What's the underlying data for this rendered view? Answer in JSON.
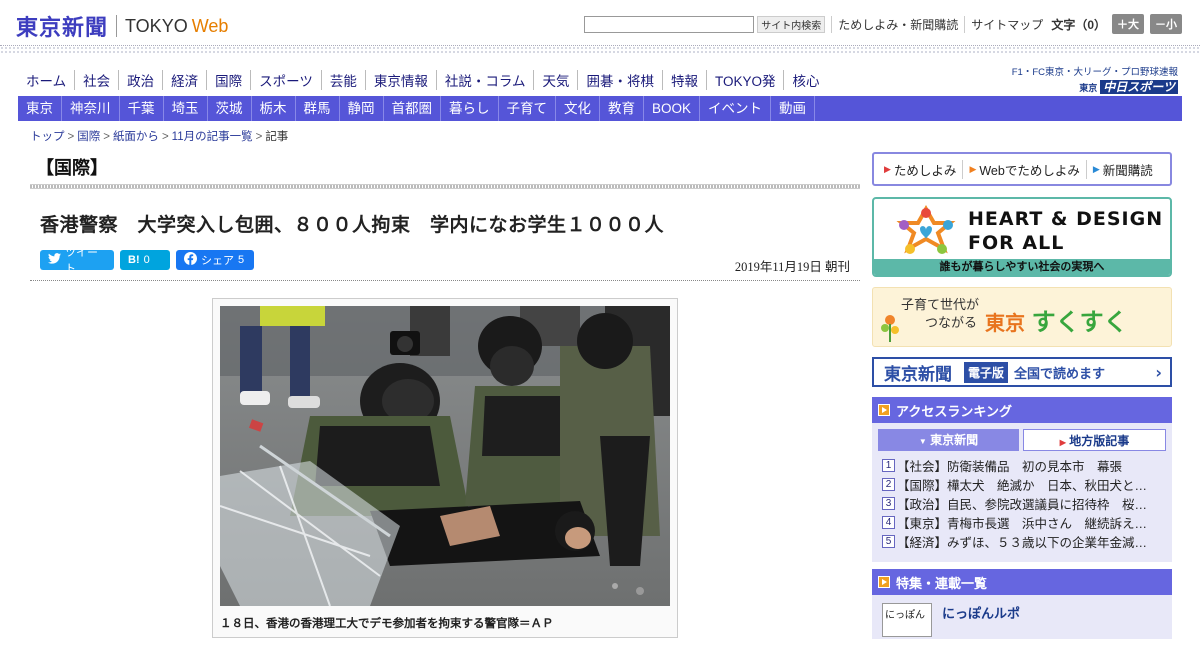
{
  "header": {
    "logo_kanji": "東京新聞",
    "logo_tokyo": "TOKYO",
    "logo_web": "Web",
    "search_value": "",
    "search_button": "サイト内検索",
    "links": [
      "ためしよみ・新聞購読",
      "サイトマップ"
    ],
    "font_label": "文字（0）",
    "font_bigger": "＋大",
    "font_smaller": "－小"
  },
  "nav_top": [
    "ホーム",
    "社会",
    "政治",
    "経済",
    "国際",
    "スポーツ",
    "芸能",
    "東京情報",
    "社説・コラム",
    "天気",
    "囲碁・将棋",
    "特報",
    "TOKYO発",
    "核心"
  ],
  "nav_brand": {
    "line1": "F1・FC東京・大リーグ・プロ野球速報",
    "prefix": "東京",
    "name": "中日スポーツ"
  },
  "nav_bottom": [
    "東京",
    "神奈川",
    "千葉",
    "埼玉",
    "茨城",
    "栃木",
    "群馬",
    "静岡",
    "首都圏",
    "暮らし",
    "子育て",
    "文化",
    "教育",
    "BOOK",
    "イベント",
    "動画"
  ],
  "breadcrumb": [
    "トップ",
    "国際",
    "紙面から",
    "11月の記事一覧",
    "記事"
  ],
  "article": {
    "section": "【国際】",
    "headline": "香港警察　大学突入し包囲、８００人拘束　学内になお学生１０００人",
    "share": {
      "tweet": "ツイート",
      "hatena": "B!",
      "hatena_count": "0",
      "facebook": "シェア",
      "facebook_count": "5"
    },
    "date": "2019年11月19日 朝刊",
    "caption": "１８日、香港の香港理工大でデモ参加者を拘束する警官隊＝ＡＰ"
  },
  "sidebar": {
    "top_links": [
      "ためしよみ",
      "Webでためしよみ",
      "新聞購読"
    ],
    "heart_line1": "HEART & DESIGN",
    "heart_line2": "FOR ALL",
    "heart_sub": "誰もが暮らしやすい社会の実現へ",
    "suku_small1": "子育て世代が",
    "suku_small2": "つながる",
    "suku_tokyo": "東京",
    "suku_name": "すくすく",
    "denshi_logo": "東京新聞",
    "denshi_tag": "電子版",
    "denshi_text": "全国で読めます",
    "ranking_title": "アクセスランキング",
    "ranking_tabs": [
      "東京新聞",
      "地方版記事"
    ],
    "ranking": [
      {
        "num": "1",
        "text": "【社会】防衛装備品　初の見本市　幕張"
      },
      {
        "num": "2",
        "text": "【国際】樺太犬　絶滅か　日本、秋田犬と…"
      },
      {
        "num": "3",
        "text": "【政治】自民、参院改選議員に招待枠　桜…"
      },
      {
        "num": "4",
        "text": "【東京】青梅市長選　浜中さん　継続訴え…"
      },
      {
        "num": "5",
        "text": "【経済】みずほ、５３歳以下の企業年金減…"
      }
    ],
    "series_title": "特集・連載一覧",
    "series_item": "にっぽんルポ",
    "series_thumb": "にっぽん"
  }
}
